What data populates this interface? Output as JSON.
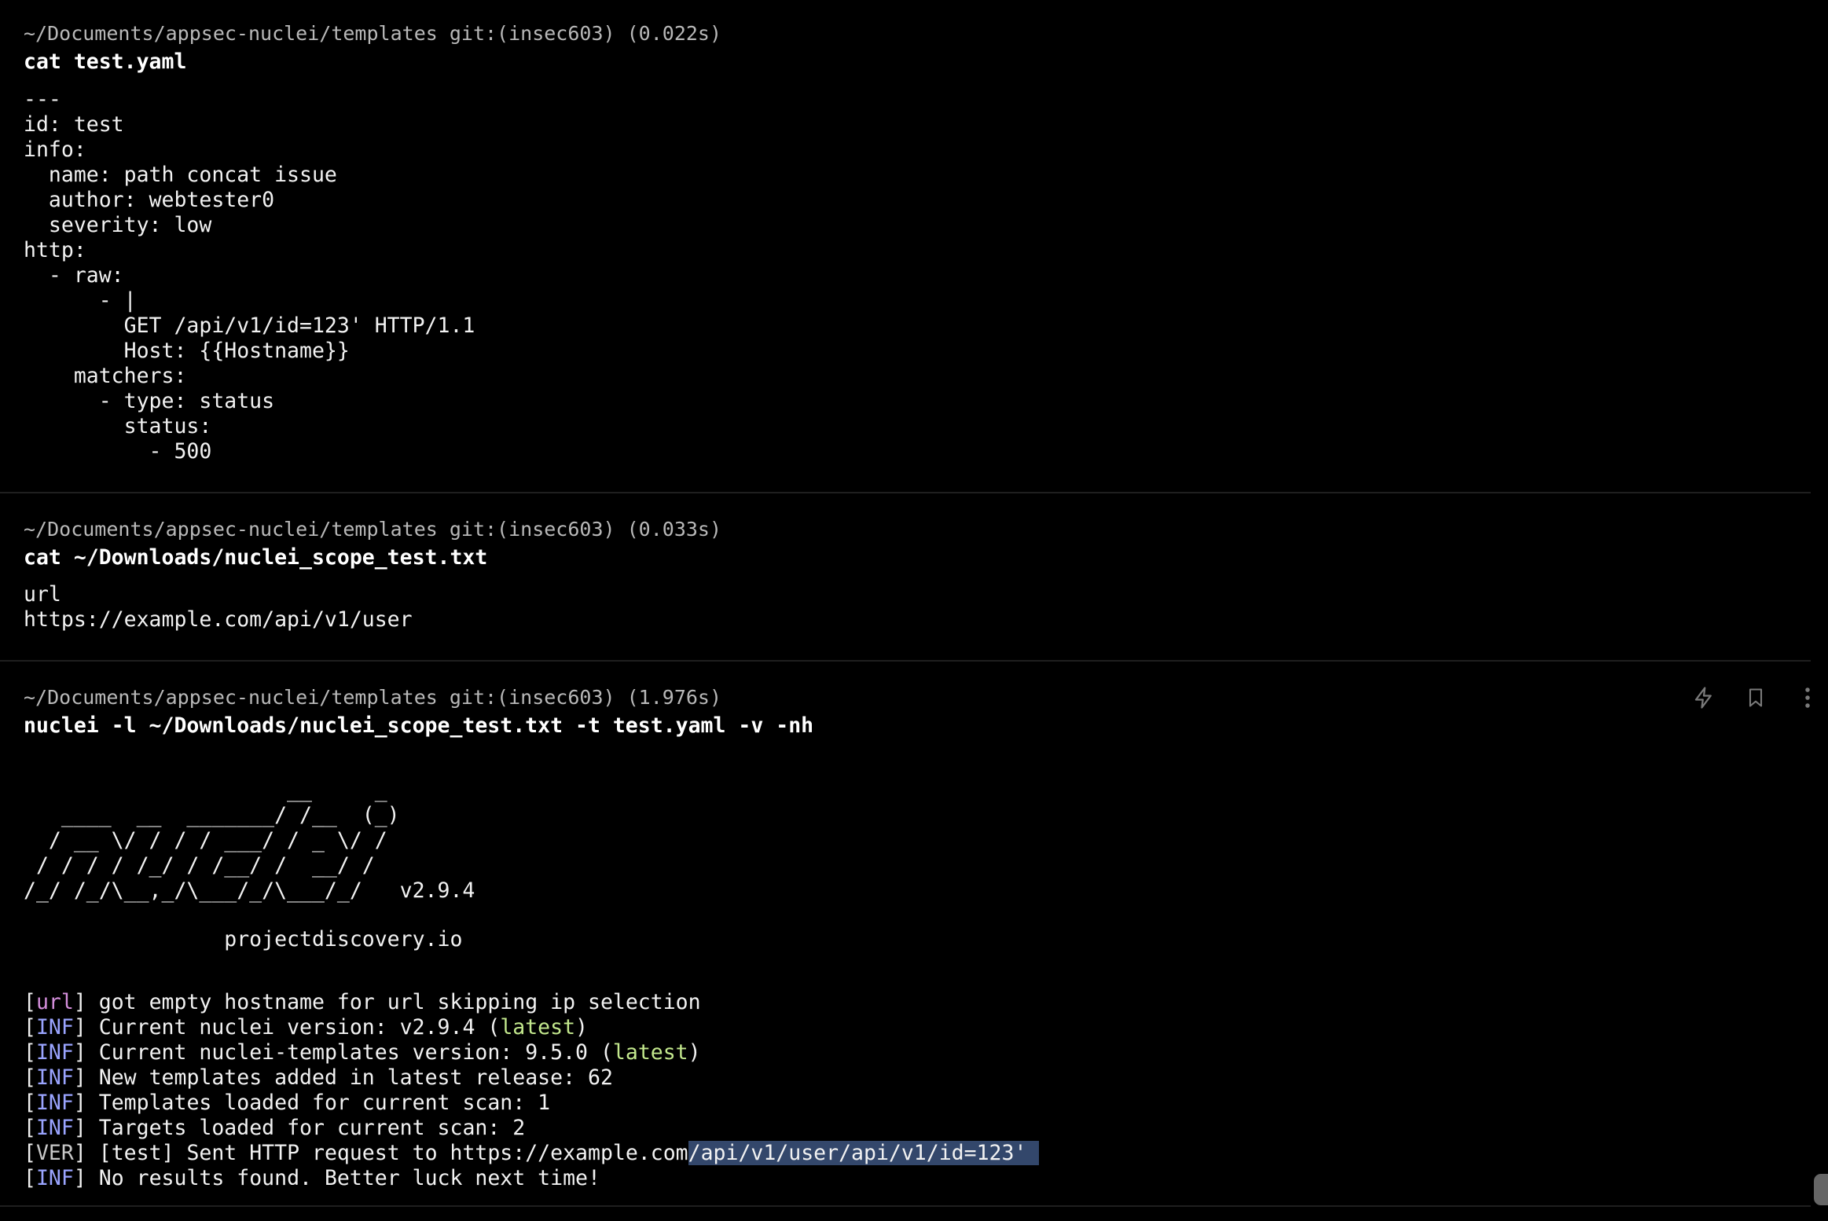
{
  "blocks": [
    {
      "prompt": "~/Documents/appsec-nuclei/templates git:(insec603) (0.022s)",
      "command": "cat test.yaml",
      "output": "---\nid: test\ninfo:\n  name: path concat issue\n  author: webtester0\n  severity: low\nhttp:\n  - raw:\n      - |\n        GET /api/v1/id=123' HTTP/1.1\n        Host: {{Hostname}}\n    matchers:\n      - type: status\n        status:\n          - 500"
    },
    {
      "prompt": "~/Documents/appsec-nuclei/templates git:(insec603) (0.033s)",
      "command": "cat ~/Downloads/nuclei_scope_test.txt",
      "output": "url\nhttps://example.com/api/v1/user"
    },
    {
      "prompt": "~/Documents/appsec-nuclei/templates git:(insec603) (1.976s)",
      "command": "nuclei -l ~/Downloads/nuclei_scope_test.txt -t test.yaml -v -nh",
      "banner": "                     __     _\n   ____  __  _______/ /__  (_)\n  / __ \\/ / / / ___/ / _ \\/ /\n / / / / /_/ / /__/ /  __/ /\n/_/ /_/\\__,_/\\___/_/\\___/_/   v2.9.4",
      "site": "                projectdiscovery.io",
      "log": [
        {
          "tag": "url",
          "text": " got empty hostname for url skipping ip selection"
        },
        {
          "tag": "INF",
          "text": " Current nuclei version: v2.9.4 (",
          "green": "latest",
          "after": ")"
        },
        {
          "tag": "INF",
          "text": " Current nuclei-templates version: 9.5.0 (",
          "green": "latest",
          "after": ")"
        },
        {
          "tag": "INF",
          "text": " New templates added in latest release: 62"
        },
        {
          "tag": "INF",
          "text": " Templates loaded for current scan: 1"
        },
        {
          "tag": "INF",
          "text": " Targets loaded for current scan: 2"
        },
        {
          "tag": "VER",
          "text": " [test] Sent HTTP request to https://example.com",
          "highlight": "/api/v1/user/api/v1/id=123' "
        },
        {
          "tag": "INF",
          "text": " No results found. Better luck next time!"
        }
      ]
    }
  ],
  "actions": [
    {
      "icon": "lightning-icon"
    },
    {
      "icon": "bookmark-icon"
    },
    {
      "icon": "more-vertical-icon"
    }
  ],
  "colors": {
    "background": "#000000",
    "url_tag": "#d58fdc",
    "inf_tag": "#9aa4ff",
    "latest": "#c3e88d",
    "selection": "#33476b"
  }
}
